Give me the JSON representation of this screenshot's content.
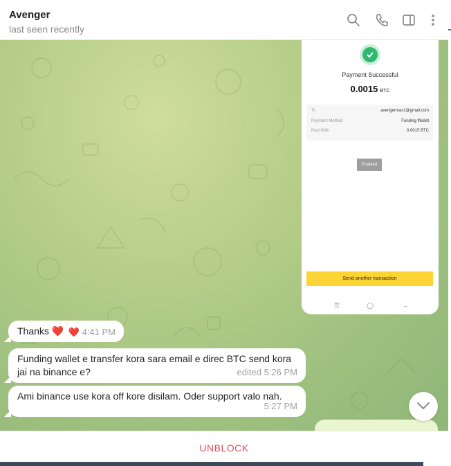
{
  "header": {
    "title": "Avenger",
    "subtitle": "last seen recently",
    "icons": [
      "search-icon",
      "phone-icon",
      "sidebar-toggle-icon",
      "more-vertical-icon"
    ]
  },
  "screenshot": {
    "title": "Payment Successful",
    "amount": "0.0015",
    "amount_unit": "BTC",
    "details": [
      {
        "label": "To",
        "value": "avengermax1@gmail.com"
      },
      {
        "label": "Payment Method",
        "value": "Funding Wallet"
      },
      {
        "label": "Paid With",
        "value": "0.0015 BTC"
      }
    ],
    "status_button": "Enabled",
    "action_button": "Send another transaction",
    "nav_icons": [
      "menu-icon",
      "home-icon",
      "back-icon"
    ]
  },
  "messages": [
    {
      "text": "Thanks ❤️",
      "reaction": "❤️",
      "time": "4:41 PM"
    },
    {
      "text": "Funding wallet e transfer kora sara email e direc BTC send kora jai na binance e?",
      "time": "edited 5:26 PM"
    },
    {
      "text": "Ami binance use kora off kore disilam. Oder support valo nah.",
      "time": "5:27 PM"
    }
  ],
  "footer": {
    "unblock_label": "UNBLOCK"
  },
  "colors": {
    "accent": "#e0535d",
    "success": "#2eb872",
    "binance_yellow": "#fcd535"
  }
}
